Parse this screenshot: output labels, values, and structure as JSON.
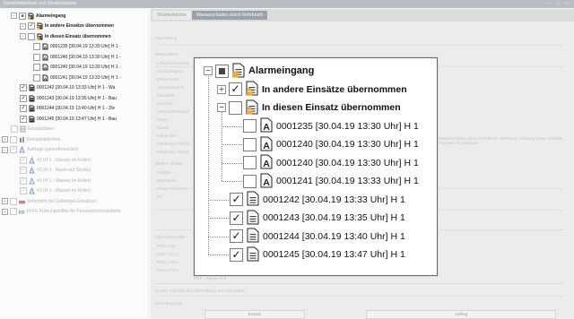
{
  "window": {
    "title": "Einsatzbibliothek und Strukturbäume",
    "controls": "— ▢ ✕"
  },
  "tree": [
    {
      "label": "Alarmeingang",
      "bold": true,
      "checked": "partial",
      "expander": "−",
      "icon": "doc-orange"
    },
    {
      "label": "In andere Einsätze übernommen",
      "bold": true,
      "checked": "checked",
      "expander": "+",
      "icon": "doc-people"
    },
    {
      "label": "In diesen Einsatz übernommen",
      "bold": true,
      "checked": "unchecked",
      "expander": "−",
      "icon": "doc-people"
    },
    {
      "label": "0001235 [30.04.19 13:30 Uhr] H 1 -",
      "checked": "unchecked",
      "icon": "doc-a"
    },
    {
      "label": "0001240 [30.04.19 13:30 Uhr] H 1 -",
      "checked": "unchecked",
      "icon": "doc-a"
    },
    {
      "label": "0001240 [30.04.19 13:30 Uhr] H 1 -",
      "checked": "unchecked",
      "icon": "doc-a"
    },
    {
      "label": "0001241 [30.04.19 13:33 Uhr] H 1 -",
      "checked": "unchecked",
      "icon": "doc-a"
    },
    {
      "label": "0001242 [30.04.19 13:33 Uhr] H 1 - Wa",
      "checked": "checked",
      "icon": "doc"
    },
    {
      "label": "0001243 [30.04.19 13:35 Uhr] H 1 - Bau",
      "checked": "checked",
      "icon": "doc"
    },
    {
      "label": "0001244 [30.04.19 13:40 Uhr] H 1 - Zie",
      "checked": "checked",
      "icon": "doc"
    },
    {
      "label": "0001245 [30.04.19 13:47 Uhr] H 1 - Bau",
      "checked": "checked",
      "icon": "doc"
    },
    {
      "label": "Einsatzdaten",
      "faded": true,
      "checked": "unchecked",
      "icon": "grid"
    },
    {
      "label": "Einsatzbibliothek",
      "faded": true,
      "checked": "unchecked",
      "expander": "+",
      "icon": "books"
    },
    {
      "label": "Aufträge (georeferenziert)",
      "faded": true,
      "checked": "checked",
      "expander": "−",
      "icon": "tri"
    },
    {
      "label": "#2 (H 1 - Wasser im Keller)",
      "faded": true,
      "checked": "checked",
      "icon": "tri"
    },
    {
      "label": "#3 (H 1 - Baum auf Straße)",
      "faded": true,
      "checked": "checked",
      "icon": "tri"
    },
    {
      "label": "#4 (H 1 - Wasser im Keller)",
      "faded": true,
      "checked": "checked",
      "icon": "tri-plain"
    },
    {
      "label": "#1 (H 1 - Wasser im Keller)",
      "faded": true,
      "checked": "checked",
      "icon": "tri"
    },
    {
      "label": "Soforthilfe bei Gefahrgut-Einsätzen",
      "faded": true,
      "checked": "unchecked",
      "expander": "+",
      "icon": "truck"
    },
    {
      "label": "FFFE Führungshilfen für Feuerwehreinsatzleite",
      "faded": true,
      "checked": "unchecked",
      "expander": "+",
      "icon": "fffe"
    }
  ],
  "tabs": [
    {
      "label": "Strukturbäume"
    },
    {
      "label": "Wasserschaden durch Rohrbruch"
    }
  ],
  "panel": {
    "sections": [
      "Alarmierung",
      "Stammdaten",
      "Einsatzdaten",
      "Weitere Inhalte",
      "Alarmierte Kräfte",
      "Alarmierungen"
    ],
    "fields": [
      "Leitstellennummer",
      "Einsatzbeginn",
      "Einsatzende",
      "Alarmstichwort",
      "Meldebild",
      "Anschrift",
      "Gemeinde/Ortsteil",
      "Name",
      "Zusatz",
      "Meldender",
      "Meldender Telefon",
      "Meldender Zusatz",
      "Objekte",
      "Objektteile",
      "Anzahl Personen",
      "Art"
    ],
    "note": "Wasserschaden durch Rohrbruch, Wohnung, Meldung eines Leitstelle Personen im Gebäude",
    "kraefte": [
      "RDG 3-66",
      "RDG 3-11-1",
      "RDG 3-36-1",
      "RDG 3-40-1"
    ],
    "kraefte_extra": "DGF - Rotges Rdt",
    "footnote": "Quelle: Formular zur Übermittlung von Alarmdaten",
    "comment_label": "Bemerkung als",
    "buttons": {
      "left": "Einsatz",
      "right": "Auftrag"
    }
  },
  "zoom": [
    {
      "label": "Alarmeingang",
      "checked": "partial",
      "expander": "−",
      "icon": "doc-orange"
    },
    {
      "label": "In andere Einsätze übernommen",
      "checked": "checked",
      "expander": "+",
      "icon": "doc-people"
    },
    {
      "label": "In diesen Einsatz übernommen",
      "checked": "unchecked",
      "expander": "−",
      "icon": "doc-people"
    },
    {
      "label": "0001235 [30.04.19 13:30 Uhr] H 1",
      "checked": "unchecked",
      "icon": "doc-a"
    },
    {
      "label": "0001240 [30.04.19 13:30 Uhr] H 1",
      "checked": "unchecked",
      "icon": "doc-a"
    },
    {
      "label": "0001240 [30.04.19 13:30 Uhr] H 1",
      "checked": "unchecked",
      "icon": "doc-a"
    },
    {
      "label": "0001241 [30.04.19 13:33 Uhr] H 1",
      "checked": "unchecked",
      "icon": "doc-a"
    },
    {
      "label": "0001242 [30.04.19 13:33 Uhr] H 1",
      "checked": "checked",
      "icon": "doc"
    },
    {
      "label": "0001243 [30.04.19 13:35 Uhr] H 1",
      "checked": "checked",
      "icon": "doc"
    },
    {
      "label": "0001244 [30.04.19 13:40 Uhr] H 1",
      "checked": "checked",
      "icon": "doc"
    },
    {
      "label": "0001245 [30.04.19 13:47 Uhr] H 1",
      "checked": "checked",
      "icon": "doc"
    }
  ],
  "colors": {
    "accent_orange": "#f2a93b",
    "tab_active": "#9ba2aa",
    "checkmark": "#111111"
  }
}
